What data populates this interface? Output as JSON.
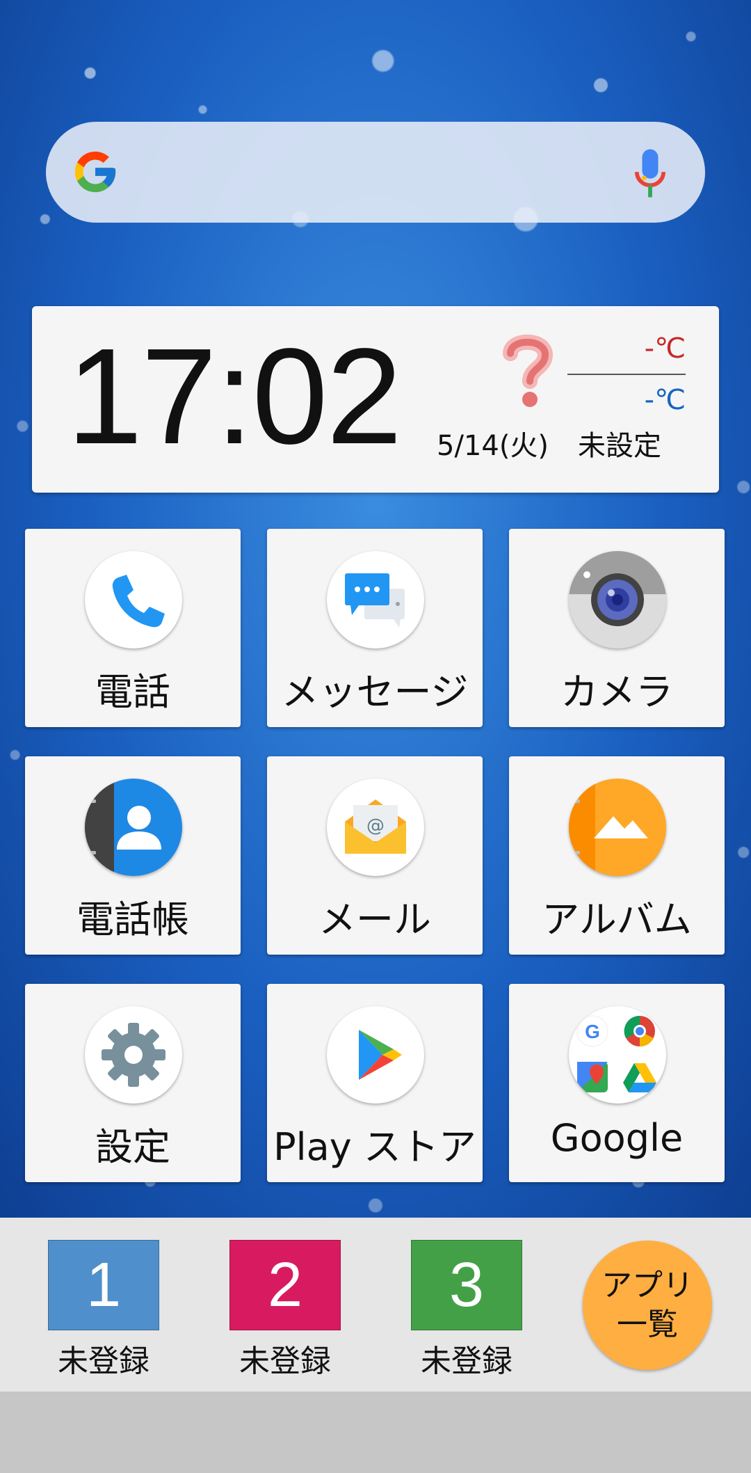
{
  "search": {
    "logo": "google-g-icon",
    "mic": "microphone-icon"
  },
  "clock": {
    "time": "17:02",
    "date": "5/14(火)",
    "weather_icon": "question-mark-icon",
    "temp_high": "-℃",
    "temp_low": "-℃",
    "location": "未設定"
  },
  "apps": [
    {
      "label": "電話",
      "icon": "phone-icon"
    },
    {
      "label": "メッセージ",
      "icon": "message-icon"
    },
    {
      "label": "カメラ",
      "icon": "camera-icon"
    },
    {
      "label": "電話帳",
      "icon": "contacts-icon"
    },
    {
      "label": "メール",
      "icon": "mail-icon"
    },
    {
      "label": "アルバム",
      "icon": "album-icon"
    },
    {
      "label": "設定",
      "icon": "settings-gear-icon"
    },
    {
      "label": "Play ストア",
      "icon": "play-store-icon"
    },
    {
      "label": "Google",
      "icon": "google-apps-folder-icon"
    }
  ],
  "dock": {
    "shortcuts": [
      {
        "number": "1",
        "label": "未登録",
        "color": "#4f8fcb"
      },
      {
        "number": "2",
        "label": "未登録",
        "color": "#d81b60"
      },
      {
        "number": "3",
        "label": "未登録",
        "color": "#43a047"
      }
    ],
    "app_list_line1": "アプリ",
    "app_list_line2": "一覧",
    "app_list_color": "#ffae42"
  }
}
